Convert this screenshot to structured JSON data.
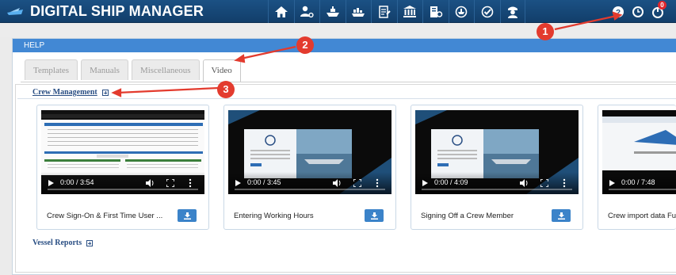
{
  "header": {
    "app_title": "DIGITAL SHIP MANAGER",
    "nav_icons": [
      "home-icon",
      "user-settings-icon",
      "ship-icon",
      "cargo-ship-icon",
      "document-edit-icon",
      "bank-icon",
      "reports-icon",
      "fleet-icon",
      "checklist-icon",
      "captain-icon"
    ],
    "right_icons": [
      "help-icon",
      "clock-icon",
      "notification-icon"
    ],
    "notification_count": "0"
  },
  "panel": {
    "title": "HELP",
    "tabs": [
      {
        "label": "Templates",
        "active": false
      },
      {
        "label": "Manuals",
        "active": false
      },
      {
        "label": "Miscellaneous",
        "active": false
      },
      {
        "label": "Video",
        "active": true
      }
    ]
  },
  "sections": {
    "crew": {
      "label": "Crew Management"
    },
    "vessel": {
      "label": "Vessel Reports"
    }
  },
  "videos": [
    {
      "title": "Crew Sign-On & First Time User ...",
      "time": "0:00 / 3:54"
    },
    {
      "title": "Entering Working Hours",
      "time": "0:00 / 3:45"
    },
    {
      "title": "Signing Off a Crew Member",
      "time": "0:00 / 4:09"
    },
    {
      "title": "Crew import data Fu",
      "time": "0:00 / 7:48"
    }
  ],
  "annotations": [
    "1",
    "2",
    "3"
  ],
  "colors": {
    "topbar": "#1b5184",
    "panel_header": "#4288d4",
    "download_button": "#3b83c9",
    "annotation": "#e33b2e",
    "link": "#2a4f84"
  }
}
